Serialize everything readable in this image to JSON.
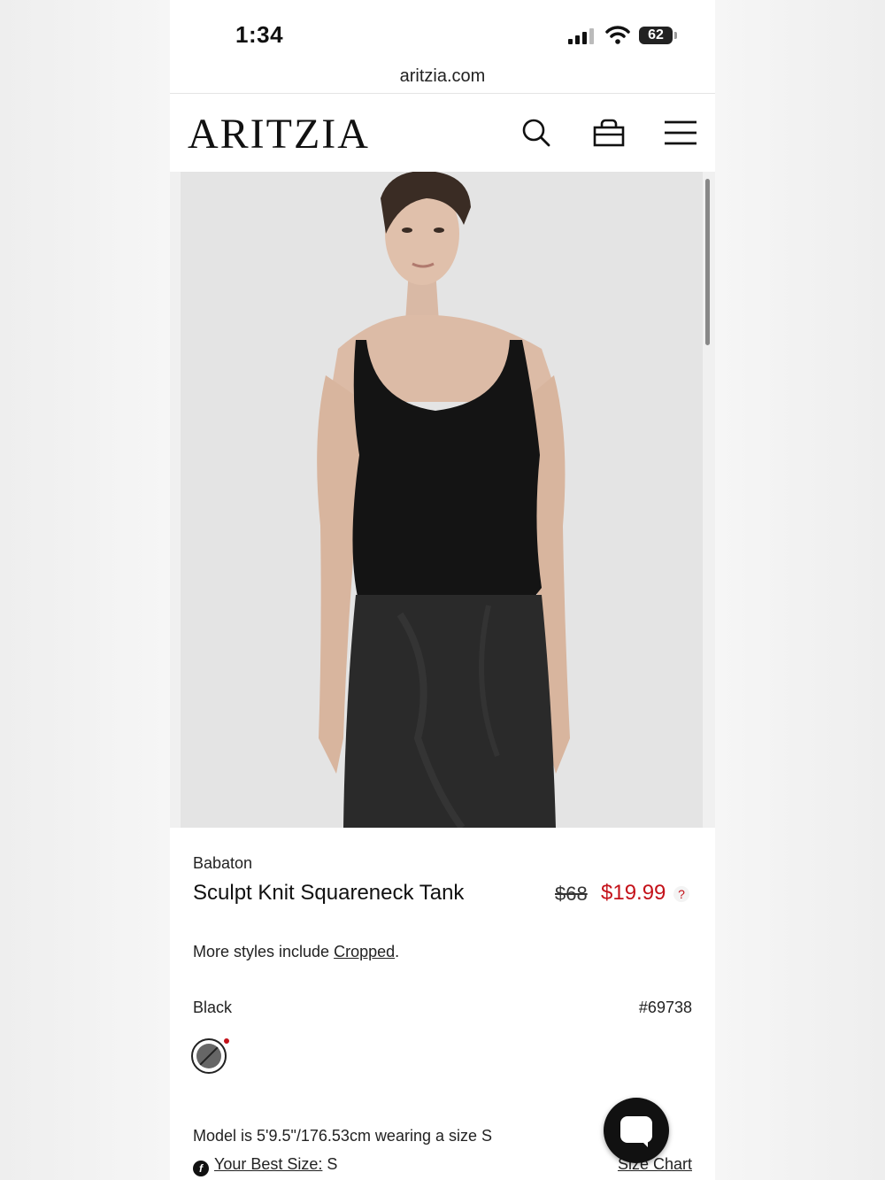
{
  "status_bar": {
    "time": "1:34",
    "battery": "62"
  },
  "browser": {
    "url": "aritzia.com"
  },
  "header": {
    "logo": "ARITZIA",
    "icons": [
      "search-icon",
      "shopping-bag-icon",
      "hamburger-menu-icon"
    ]
  },
  "product": {
    "brand": "Babaton",
    "name": "Sculpt Knit Squareneck Tank",
    "original_price": "$68",
    "sale_price": "$19.99",
    "price_help": "?",
    "more_styles_prefix": "More styles include ",
    "more_styles_link": "Cropped",
    "more_styles_suffix": ".",
    "color": "Black",
    "style_number": "#69738",
    "model_info": "Model is 5'9.5\"/176.53cm wearing a size S",
    "best_size_label": "Your Best Size:",
    "best_size_value": " S",
    "fit_icon_glyph": "f",
    "size_chart": "Size Chart"
  },
  "colors": {
    "sale": "#c4121a",
    "text": "#111111",
    "swatch": "#666666"
  }
}
